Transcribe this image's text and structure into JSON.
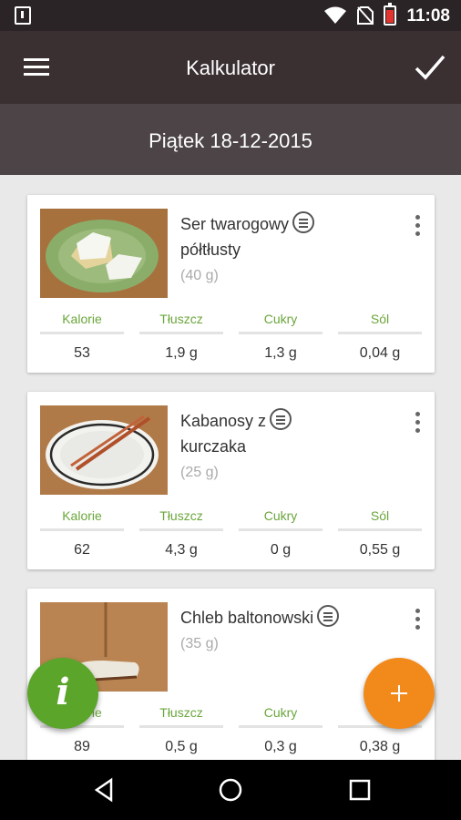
{
  "status_bar": {
    "time": "11:08"
  },
  "app_bar": {
    "title": "Kalkulator"
  },
  "date_bar": {
    "date": "Piątek 18-12-2015"
  },
  "nutrient_labels": [
    "Kalorie",
    "Tłuszcz",
    "Cukry",
    "Sól"
  ],
  "foods": [
    {
      "name_line1": "Ser twarogowy",
      "name_line2": "półtłusty",
      "weight": "(40 g)",
      "values": [
        "53",
        "1,9 g",
        "1,3 g",
        "0,04 g"
      ]
    },
    {
      "name_line1": "Kabanosy z",
      "name_line2": "kurczaka",
      "weight": "(25 g)",
      "values": [
        "62",
        "4,3 g",
        "0 g",
        "0,55 g"
      ]
    },
    {
      "name_line1": "Chleb baltonowski",
      "name_line2": "",
      "weight": "(35 g)",
      "values": [
        "89",
        "0,5 g",
        "0,3 g",
        "0,38 g"
      ]
    }
  ],
  "fab": {
    "info_glyph": "i"
  },
  "colors": {
    "accent_green": "#6aa63a",
    "fab_green": "#5aa52a",
    "fab_orange": "#f28a1b",
    "appbar": "#3a2f31"
  }
}
